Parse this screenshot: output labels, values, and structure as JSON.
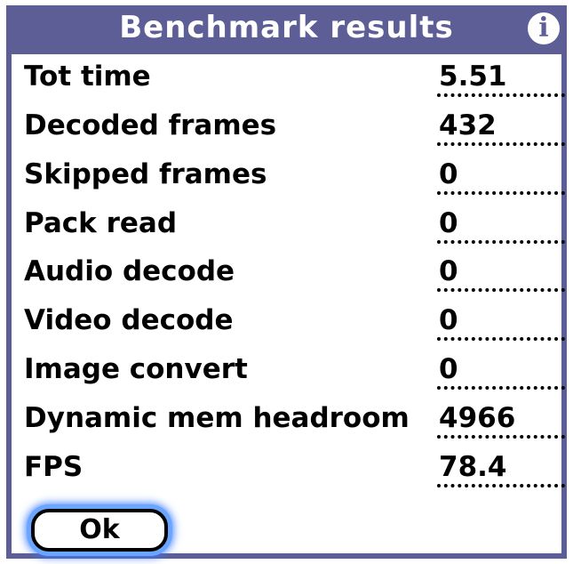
{
  "dialog": {
    "title": "Benchmark results",
    "info_icon": "info-icon",
    "ok_label": "Ok",
    "colors": {
      "title_bar": "#5e5e96",
      "focus_ring": "#3b7bff"
    }
  },
  "rows": [
    {
      "label": "Tot time",
      "value": "5.51"
    },
    {
      "label": "Decoded frames",
      "value": "432"
    },
    {
      "label": "Skipped frames",
      "value": "0"
    },
    {
      "label": "Pack read",
      "value": "0"
    },
    {
      "label": "Audio decode",
      "value": "0"
    },
    {
      "label": "Video decode",
      "value": "0"
    },
    {
      "label": "Image convert",
      "value": "0"
    },
    {
      "label": "Dynamic mem headroom",
      "value": "4966"
    },
    {
      "label": "FPS",
      "value": "78.4"
    }
  ]
}
